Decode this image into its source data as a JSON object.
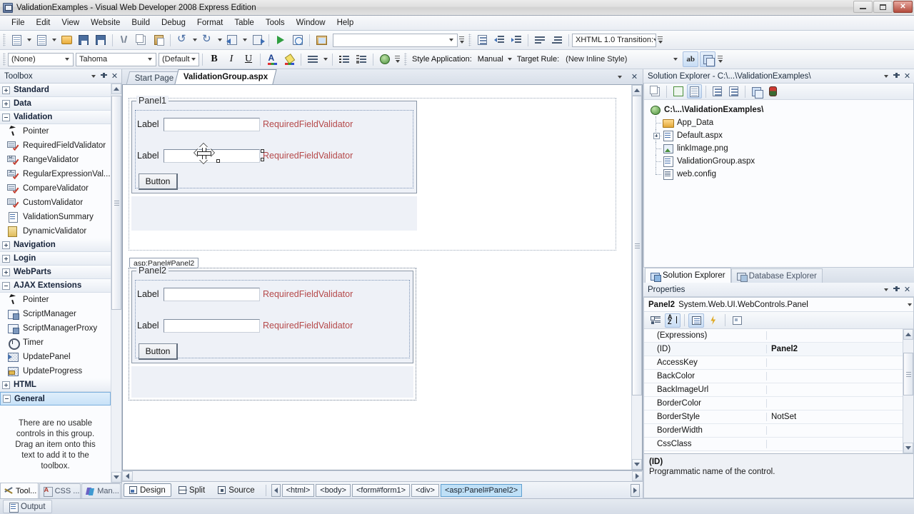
{
  "window": {
    "title": "ValidationExamples - Visual Web Developer 2008 Express Edition",
    "minimize": "–",
    "maximize": "□",
    "close": "✕"
  },
  "menubar": {
    "items": [
      "File",
      "Edit",
      "View",
      "Website",
      "Build",
      "Debug",
      "Format",
      "Table",
      "Tools",
      "Window",
      "Help"
    ]
  },
  "toolbar_standard": {
    "buttons": [
      {
        "name": "new-website-button",
        "icon": "new-document-icon"
      },
      {
        "name": "add-new-item-button",
        "icon": "add-item-icon"
      },
      {
        "name": "open-file-button",
        "icon": "open-folder-icon"
      },
      {
        "name": "save-button",
        "icon": "save-icon"
      },
      {
        "name": "save-all-button",
        "icon": "save-all-icon"
      },
      {
        "name": "cut-button",
        "icon": "scissors-icon"
      },
      {
        "name": "copy-button",
        "icon": "copy-icon"
      },
      {
        "name": "paste-button",
        "icon": "clipboard-paste-icon"
      },
      {
        "name": "undo-button",
        "icon": "undo-arrow-icon"
      },
      {
        "name": "redo-button",
        "icon": "redo-arrow-icon"
      },
      {
        "name": "navigate-backward-button",
        "icon": "navigate-back-icon"
      },
      {
        "name": "navigate-forward-button",
        "icon": "navigate-forward-icon"
      },
      {
        "name": "start-debugging-button",
        "icon": "green-play-icon"
      },
      {
        "name": "view-in-browser-button",
        "icon": "browser-globe-icon"
      },
      {
        "name": "picture-button",
        "icon": "image-icon"
      }
    ],
    "find_combo_value": "",
    "find_combo_placeholder": ""
  },
  "toolbar_formatting": {
    "block_format": "(None)",
    "font_family": "Tahoma",
    "font_size": "(Default",
    "bold": "B",
    "italic": "I",
    "underline": "U",
    "foreground_color": "foreground-color-icon",
    "highlight": "highlight-icon",
    "align": "align-left-icon",
    "bullets": "bullet-list-icon",
    "numbering": "numbered-list-icon",
    "hyperlink": "hyperlink-globe-icon"
  },
  "toolbar_style": {
    "style_application_label": "Style Application:",
    "style_application_value": "Manual",
    "target_rule_label": "Target Rule:",
    "target_rule_value": "(New Inline Style)",
    "buttons": [
      {
        "name": "apply-styles-button",
        "icon": "ab-pencil-icon"
      },
      {
        "name": "manage-styles-button",
        "icon": "layers-icon"
      }
    ]
  },
  "toolbar_html": {
    "buttons": [
      {
        "name": "css-block-button",
        "icon": "css-block-icon"
      },
      {
        "name": "decrease-indent-button",
        "icon": "decrease-indent-icon"
      },
      {
        "name": "increase-indent-button",
        "icon": "increase-indent-icon"
      },
      {
        "name": "justify-left-button",
        "icon": "justify-left-icon"
      },
      {
        "name": "subscript-button",
        "icon": "justify-sub-icon"
      }
    ],
    "doctype": "XHTML 1.0 Transition:"
  },
  "toolbox": {
    "title": "Toolbox",
    "groups": [
      {
        "label": "Standard",
        "expanded": false,
        "items": []
      },
      {
        "label": "Data",
        "expanded": false,
        "items": []
      },
      {
        "label": "Validation",
        "expanded": true,
        "items": [
          {
            "label": "Pointer",
            "icon": "pointer-icon"
          },
          {
            "label": "RequiredFieldValidator",
            "icon": "required-field-validator-icon"
          },
          {
            "label": "RangeValidator",
            "icon": "range-validator-icon"
          },
          {
            "label": "RegularExpressionVal...",
            "icon": "regex-validator-icon"
          },
          {
            "label": "CompareValidator",
            "icon": "compare-validator-icon"
          },
          {
            "label": "CustomValidator",
            "icon": "custom-validator-icon"
          },
          {
            "label": "ValidationSummary",
            "icon": "validation-summary-icon"
          },
          {
            "label": "DynamicValidator",
            "icon": "dynamic-validator-icon"
          }
        ]
      },
      {
        "label": "Navigation",
        "expanded": false,
        "items": []
      },
      {
        "label": "Login",
        "expanded": false,
        "items": []
      },
      {
        "label": "WebParts",
        "expanded": false,
        "items": []
      },
      {
        "label": "AJAX Extensions",
        "expanded": true,
        "items": [
          {
            "label": "Pointer",
            "icon": "pointer-icon"
          },
          {
            "label": "ScriptManager",
            "icon": "script-manager-icon"
          },
          {
            "label": "ScriptManagerProxy",
            "icon": "script-manager-proxy-icon"
          },
          {
            "label": "Timer",
            "icon": "timer-icon"
          },
          {
            "label": "UpdatePanel",
            "icon": "update-panel-icon"
          },
          {
            "label": "UpdateProgress",
            "icon": "update-progress-icon"
          }
        ]
      },
      {
        "label": "HTML",
        "expanded": false,
        "items": []
      },
      {
        "label": "General",
        "expanded": true,
        "selected": true,
        "items": []
      }
    ],
    "empty_message": "There are no usable controls in this group. Drag an item onto this text to add it to the toolbox.",
    "tabs": [
      {
        "label": "Tool...",
        "icon": "toolbox-icon",
        "active": true
      },
      {
        "label": "CSS ...",
        "icon": "css-properties-icon",
        "active": false
      },
      {
        "label": "Man...",
        "icon": "manage-styles-icon",
        "active": false
      }
    ]
  },
  "editor": {
    "tabs": [
      {
        "label": "Start Page",
        "active": false
      },
      {
        "label": "ValidationGroup.aspx",
        "active": true
      }
    ],
    "panels": [
      {
        "legend": "Panel1",
        "tag_badge": null,
        "rows": [
          {
            "label": "Label",
            "validator": "RequiredFieldValidator"
          },
          {
            "label": "Label",
            "validator": "RequiredFieldValidator"
          }
        ],
        "button": "Button"
      },
      {
        "legend": "Panel2",
        "tag_badge": "asp:Panel#Panel2",
        "rows": [
          {
            "label": "Label",
            "validator": "RequiredFieldValidator"
          },
          {
            "label": "Label",
            "validator": "RequiredFieldValidator"
          }
        ],
        "button": "Button"
      }
    ],
    "view_buttons": [
      {
        "label": "Design",
        "icon": "design-view-icon",
        "active": true
      },
      {
        "label": "Split",
        "icon": "split-view-icon",
        "active": false
      },
      {
        "label": "Source",
        "icon": "source-view-icon",
        "active": false
      }
    ],
    "breadcrumb": [
      {
        "label": "<html>",
        "active": false
      },
      {
        "label": "<body>",
        "active": false
      },
      {
        "label": "<form#form1>",
        "active": false
      },
      {
        "label": "<div>",
        "active": false
      },
      {
        "label": "<asp:Panel#Panel2>",
        "active": true
      }
    ]
  },
  "solution_explorer": {
    "title": "Solution Explorer - C:\\...\\ValidationExamples\\",
    "toolbar": [
      {
        "name": "properties-window-button",
        "icon": "properties-pages-icon"
      },
      {
        "name": "refresh-button",
        "icon": "refresh-icon"
      },
      {
        "name": "nest-related-files-button",
        "icon": "nest-files-icon",
        "active": true
      },
      {
        "name": "view-code-button",
        "icon": "view-code-icon"
      },
      {
        "name": "view-designer-button",
        "icon": "view-designer-icon"
      },
      {
        "name": "copy-website-button",
        "icon": "copy-website-icon"
      },
      {
        "name": "asp-configuration-button",
        "icon": "asp-config-icon"
      }
    ],
    "tree": [
      {
        "label": "C:\\...\\ValidationExamples\\",
        "icon": "project-globe-icon",
        "depth": 0,
        "root": true,
        "expander": false
      },
      {
        "label": "App_Data",
        "icon": "folder-icon",
        "depth": 1,
        "expander": false
      },
      {
        "label": "Default.aspx",
        "icon": "aspx-file-icon",
        "depth": 1,
        "expander": true
      },
      {
        "label": "linkImage.png",
        "icon": "png-file-icon",
        "depth": 1,
        "expander": false
      },
      {
        "label": "ValidationGroup.aspx",
        "icon": "aspx-file-icon",
        "depth": 1,
        "expander": false
      },
      {
        "label": "web.config",
        "icon": "config-file-icon",
        "depth": 1,
        "expander": false
      }
    ],
    "tabs": [
      {
        "label": "Solution Explorer",
        "icon": "solution-explorer-icon",
        "active": true
      },
      {
        "label": "Database Explorer",
        "icon": "database-explorer-icon",
        "active": false
      }
    ]
  },
  "properties": {
    "title": "Properties",
    "object_name": "Panel2",
    "object_type": "System.Web.UI.WebControls.Panel",
    "toolbar": [
      {
        "name": "categorized-button",
        "icon": "categorized-icon"
      },
      {
        "name": "alphabetical-button",
        "icon": "alphabetical-sort-icon",
        "active": true
      },
      {
        "name": "properties-button",
        "icon": "properties-icon",
        "active": true
      },
      {
        "name": "events-button",
        "icon": "lightning-bolt-icon"
      },
      {
        "name": "property-pages-button",
        "icon": "property-pages-icon"
      }
    ],
    "rows": [
      {
        "name": "(Expressions)",
        "value": ""
      },
      {
        "name": "(ID)",
        "value": "Panel2",
        "selected": true
      },
      {
        "name": "AccessKey",
        "value": ""
      },
      {
        "name": "BackColor",
        "value": ""
      },
      {
        "name": "BackImageUrl",
        "value": ""
      },
      {
        "name": "BorderColor",
        "value": ""
      },
      {
        "name": "BorderStyle",
        "value": "NotSet"
      },
      {
        "name": "BorderWidth",
        "value": ""
      },
      {
        "name": "CssClass",
        "value": ""
      }
    ],
    "description_title": "(ID)",
    "description_text": "Programmatic name of the control."
  },
  "taskbar": {
    "items": [
      {
        "label": "Output",
        "icon": "output-window-icon"
      }
    ]
  },
  "colors": {
    "validator_red": "#b5494a",
    "selection_blue": "#bfe0f7",
    "panel_bg": "#eef1f7"
  }
}
